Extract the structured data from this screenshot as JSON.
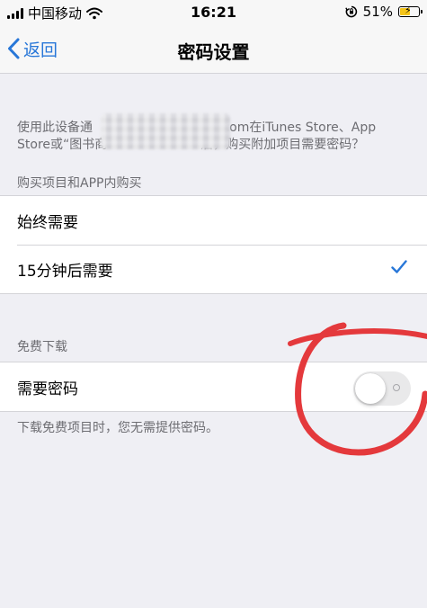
{
  "status_bar": {
    "carrier": "中国移动",
    "time": "16:21",
    "battery": "51%",
    "icons": [
      "signal-icon",
      "wifi-icon",
      "orientation-lock-icon",
      "battery-charging-icon"
    ]
  },
  "nav": {
    "back_label": "返回",
    "title": "密码设置"
  },
  "description": {
    "part_before_redaction": "使用此设备通",
    "part_line1_after": ".com在iTunes Store、App",
    "part_line2_before": "Store或“图书商",
    "part_line2_after": "后，购买附加项目需要密码？"
  },
  "purchases": {
    "header": "购买项目和APP内购买",
    "options": [
      {
        "label": "始终需要",
        "selected": false
      },
      {
        "label": "15分钟后需要",
        "selected": true
      }
    ]
  },
  "free_downloads": {
    "header": "免费下载",
    "require_password_label": "需要密码",
    "require_password_on": false,
    "footer": "下载免费项目时，您无需提供密码。"
  },
  "colors": {
    "accent": "#2877d8",
    "background": "#efeff4",
    "annotation": "#e4393c"
  }
}
